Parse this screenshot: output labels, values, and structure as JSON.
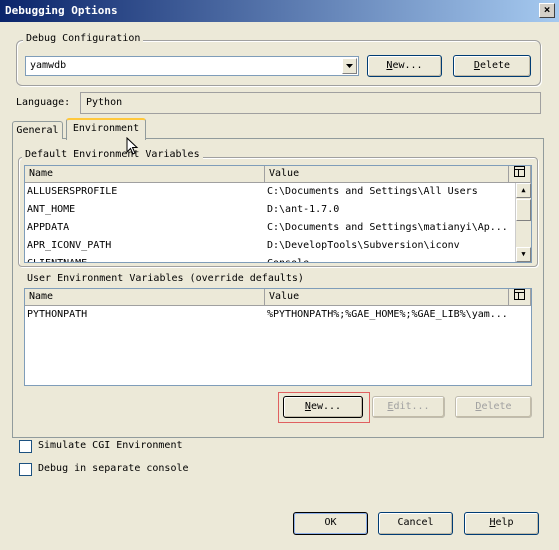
{
  "window": {
    "title": "Debugging Options",
    "close_glyph": "×"
  },
  "debug_config": {
    "legend": "Debug Configuration",
    "selected": "yamwdb",
    "new_label": "New...",
    "delete_label": "Delete"
  },
  "language": {
    "label": "Language:",
    "value": "Python"
  },
  "tabs": [
    {
      "label": "General"
    },
    {
      "label": "Environment"
    }
  ],
  "default_env": {
    "legend": "Default Environment Variables",
    "columns": {
      "name": "Name",
      "value": "Value"
    },
    "rows": [
      {
        "name": "ALLUSERSPROFILE",
        "value": "C:\\Documents and Settings\\All Users"
      },
      {
        "name": "ANT_HOME",
        "value": "D:\\ant-1.7.0"
      },
      {
        "name": "APPDATA",
        "value": "C:\\Documents and Settings\\matianyi\\Ap..."
      },
      {
        "name": "APR_ICONV_PATH",
        "value": "D:\\DevelopTools\\Subversion\\iconv"
      },
      {
        "name": "CLIENTNAME",
        "value": "Console"
      }
    ]
  },
  "user_env": {
    "legend": "User Environment Variables (override defaults)",
    "columns": {
      "name": "Name",
      "value": "Value"
    },
    "rows": [
      {
        "name": "PYTHONPATH",
        "value": "%PYTHONPATH%;%GAE_HOME%;%GAE_LIB%\\yam..."
      }
    ],
    "new_label": "New...",
    "edit_label": "Edit...",
    "delete_label": "Delete"
  },
  "options": {
    "simulate_cgi": {
      "label": "Simulate CGI Environment",
      "checked": false
    },
    "separate_console": {
      "label": "Debug in separate console",
      "checked": false
    }
  },
  "footer": {
    "ok_label": "OK",
    "cancel_label": "Cancel",
    "help_label": "Help"
  },
  "colors": {
    "titlebar": "#0a246a",
    "highlight_box": "#e06060",
    "dialog_bg": "#ece9d8"
  }
}
